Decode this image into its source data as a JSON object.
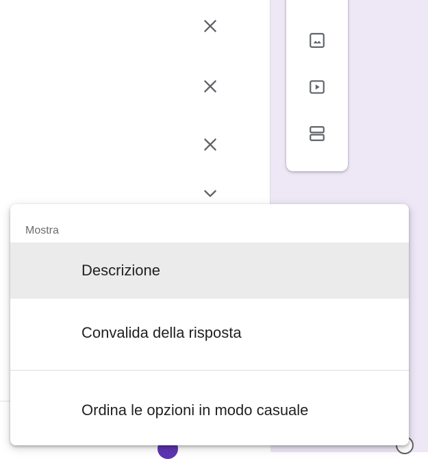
{
  "icons": {
    "remove": "close-icon",
    "expand": "chevron-down-icon",
    "add_image": "image-icon",
    "add_video": "video-icon",
    "add_section": "section-icon"
  },
  "colors": {
    "panel_background": "#ede7f6",
    "accent": "#5e35b1",
    "menu_highlight": "#ebebeb",
    "icon": "#5f6368"
  },
  "menu": {
    "header": "Mostra",
    "items": [
      {
        "label": "Descrizione",
        "highlighted": true
      },
      {
        "label": "Convalida della risposta",
        "highlighted": false
      },
      {
        "label": "Ordina le opzioni in modo casuale",
        "highlighted": false
      }
    ]
  }
}
